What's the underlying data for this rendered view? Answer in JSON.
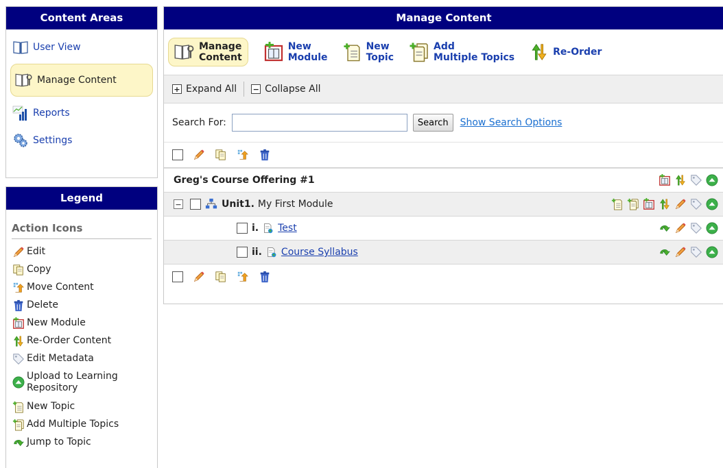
{
  "content_areas": {
    "title": "Content Areas",
    "items": [
      {
        "label": "User View",
        "icon": "book-icon"
      },
      {
        "label": "Manage Content",
        "icon": "manage-content-icon"
      },
      {
        "label": "Reports",
        "icon": "bar-chart-icon"
      },
      {
        "label": "Settings",
        "icon": "gears-icon"
      }
    ]
  },
  "legend": {
    "title": "Legend",
    "subtitle": "Action Icons",
    "items": [
      {
        "label": "Edit",
        "icon": "pencil-icon"
      },
      {
        "label": "Copy",
        "icon": "copy-icon"
      },
      {
        "label": "Move Content",
        "icon": "move-icon"
      },
      {
        "label": "Delete",
        "icon": "trash-icon"
      },
      {
        "label": "New Module",
        "icon": "new-module-icon"
      },
      {
        "label": "Re-Order Content",
        "icon": "reorder-icon"
      },
      {
        "label": "Edit Metadata",
        "icon": "tag-icon"
      },
      {
        "label": "Upload to Learning Repository",
        "icon": "upload-icon"
      },
      {
        "label": "New Topic",
        "icon": "new-topic-icon"
      },
      {
        "label": "Add Multiple Topics",
        "icon": "add-topics-icon"
      },
      {
        "label": "Jump to Topic",
        "icon": "jump-icon"
      }
    ]
  },
  "main": {
    "title": "Manage Content",
    "toolbar": {
      "manage_line1": "Manage",
      "manage_line2": "Content",
      "newmodule_line1": "New",
      "newmodule_line2": "Module",
      "newtopic_line1": "New",
      "newtopic_line2": "Topic",
      "addmulti_line1": "Add",
      "addmulti_line2": "Multiple Topics",
      "reorder": "Re-Order"
    },
    "expand_all": "Expand All",
    "collapse_all": "Collapse All",
    "search_label": "Search For:",
    "search_value": "",
    "search_button": "Search",
    "search_options": "Show Search Options",
    "course_title": "Greg's Course Offering #1",
    "module": {
      "number": "Unit1.",
      "title": "My First Module"
    },
    "topics": [
      {
        "number": "i.",
        "title": "Test"
      },
      {
        "number": "ii.",
        "title": "Course Syllabus"
      }
    ]
  },
  "colors": {
    "header_bg": "#00007f",
    "highlight_bg": "#fdf6c8",
    "link": "#1a3fae"
  }
}
